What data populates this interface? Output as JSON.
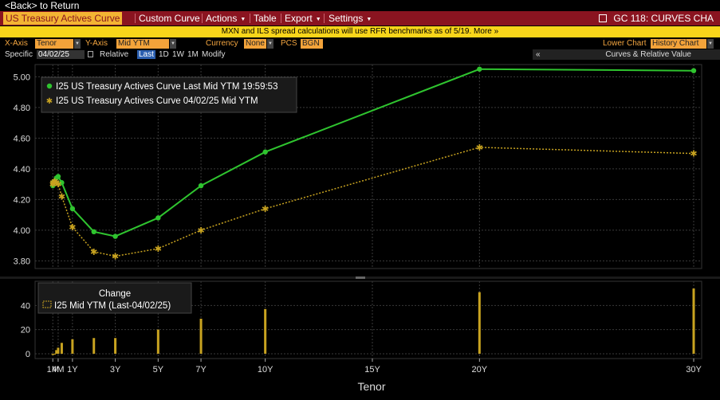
{
  "nav": {
    "back": "<Back> to Return"
  },
  "menu": {
    "title": "US Treasury Actives Curve",
    "items": [
      "Custom Curve",
      "Actions",
      "Table",
      "Export",
      "Settings"
    ],
    "right": "GC 118: CURVES CHA"
  },
  "notice": "MXN and ILS spread calculations will use RFR benchmarks as of 5/19. More »",
  "controls": {
    "xaxis_label": "X-Axis",
    "xaxis_value": "Tenor",
    "yaxis_label": "Y-Axis",
    "yaxis_value": "Mid YTM",
    "currency_label": "Currency",
    "currency_value": "None",
    "pcs_label": "PCS",
    "pcs_value": "BGN",
    "lower_chart_label": "Lower Chart",
    "lower_chart_value": "History Chart",
    "specific_label": "Specific",
    "specific_date": "04/02/25",
    "relative_label": "Relative",
    "periods": [
      "Last",
      "1D",
      "1W",
      "1M"
    ],
    "modify_label": "Modify",
    "collapse": "«",
    "panel_title": "Curves & Relative Value"
  },
  "chart_data": [
    {
      "type": "line",
      "x_categories": [
        "1M",
        "4M",
        "1Y",
        "3Y",
        "5Y",
        "7Y",
        "10Y",
        "15Y",
        "20Y",
        "30Y"
      ],
      "x": [
        0.083,
        0.167,
        0.25,
        0.333,
        0.5,
        1,
        2,
        3,
        5,
        7,
        10,
        20,
        30
      ],
      "series": [
        {
          "name": "I25 US Treasury Actives Curve Last Mid YTM 19:59:53",
          "color": "#2fc42f",
          "values": [
            4.29,
            4.31,
            4.32,
            4.34,
            4.35,
            4.31,
            4.14,
            3.99,
            3.96,
            4.08,
            4.29,
            4.51,
            5.05,
            5.04
          ],
          "x": [
            0.083,
            0.1,
            0.167,
            0.25,
            0.333,
            0.5,
            1,
            2,
            3,
            5,
            7,
            10,
            20,
            30
          ]
        },
        {
          "name": "I25 US Treasury Actives Curve 04/02/25 Mid YTM",
          "color": "#c8a320",
          "values": [
            4.3,
            4.31,
            4.32,
            4.31,
            4.3,
            4.22,
            4.02,
            3.86,
            3.83,
            3.88,
            4.0,
            4.14,
            4.54,
            4.5
          ],
          "x": [
            0.083,
            0.1,
            0.167,
            0.25,
            0.333,
            0.5,
            1,
            2,
            3,
            5,
            7,
            10,
            20,
            30
          ]
        }
      ],
      "ylim": [
        3.75,
        5.08
      ],
      "yticks": [
        "5.00",
        "4.80",
        "4.60",
        "4.40",
        "4.20",
        "4.00",
        "3.80"
      ]
    },
    {
      "type": "bar",
      "title": "Change",
      "series": [
        {
          "name": "I25 Mid YTM (Last-04/02/25)",
          "color": "#c8a320",
          "x": [
            0.083,
            0.1,
            0.167,
            0.25,
            0.333,
            0.5,
            1,
            2,
            3,
            5,
            7,
            10,
            20,
            30
          ],
          "values": [
            -1,
            0,
            0,
            3,
            5,
            9,
            12,
            13,
            13,
            20,
            29,
            37,
            51,
            54
          ]
        }
      ],
      "ylim": [
        -4,
        60
      ],
      "yticks": [
        "40",
        "20",
        "0"
      ],
      "xlabel": "Tenor"
    }
  ]
}
